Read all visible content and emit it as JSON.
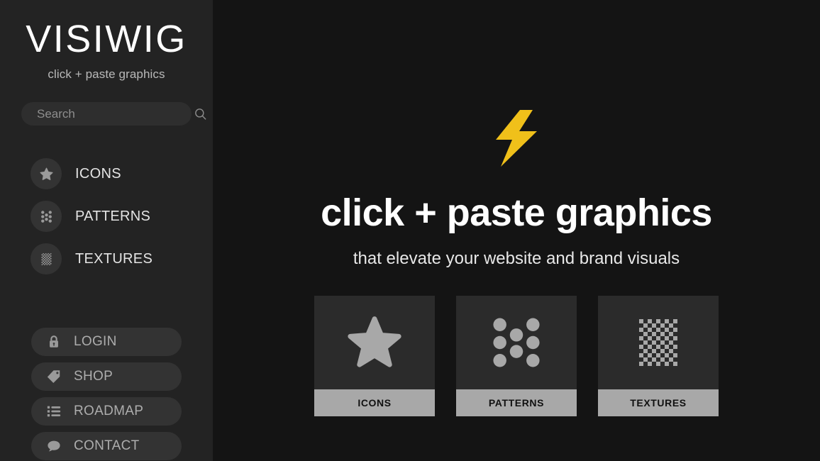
{
  "sidebar": {
    "logo": "VISIWIG",
    "tagline": "click + paste graphics",
    "search": {
      "placeholder": "Search",
      "value": "",
      "icon": "search-icon"
    },
    "nav": [
      {
        "label": "ICONS",
        "icon": "star-icon"
      },
      {
        "label": "PATTERNS",
        "icon": "dots-grid-icon"
      },
      {
        "label": "TEXTURES",
        "icon": "checkerboard-icon"
      }
    ],
    "buttons": [
      {
        "label": "LOGIN",
        "icon": "lock-icon"
      },
      {
        "label": "SHOP",
        "icon": "tag-icon"
      },
      {
        "label": "ROADMAP",
        "icon": "list-icon"
      },
      {
        "label": "CONTACT",
        "icon": "speech-bubble-icon"
      }
    ]
  },
  "main": {
    "hero": {
      "icon": "lightning-bolt-icon",
      "title": "click + paste graphics",
      "subtitle": "that elevate your website and brand visuals"
    },
    "cards": [
      {
        "label": "ICONS",
        "icon": "star-icon"
      },
      {
        "label": "PATTERNS",
        "icon": "dots-grid-icon"
      },
      {
        "label": "TEXTURES",
        "icon": "checkerboard-icon"
      }
    ]
  },
  "colors": {
    "sidebar_bg": "#232323",
    "main_bg": "#141414",
    "accent_yellow": "#f0c01a",
    "icon_gray": "#a8a8a8",
    "card_bg": "#2b2b2b",
    "card_label_bg": "#a8a8a8"
  }
}
